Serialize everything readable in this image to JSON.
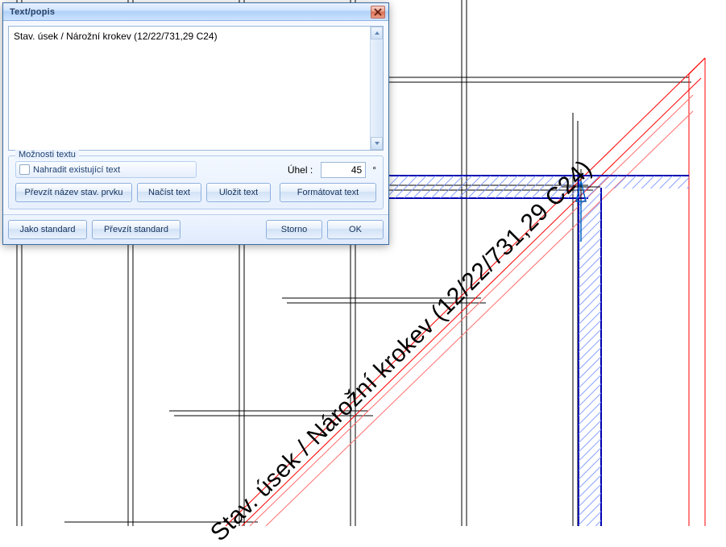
{
  "dialog": {
    "title": "Text/popis",
    "textarea_value": "Stav. úsek / Nárožní krokev (12/22/731,29 C24)",
    "options": {
      "legend": "Možnosti textu",
      "replace_label": "Nahradit existující text",
      "angle_label": "Úhel :",
      "angle_value": "45",
      "degree": "°",
      "btn_take_name": "Převzít název stav. prvku",
      "btn_load": "Načíst text",
      "btn_save": "Uložit text",
      "btn_format": "Formátovat text"
    },
    "footer": {
      "as_standard": "Jako standard",
      "take_standard": "Převzít standard",
      "storno": "Storno",
      "ok": "OK"
    }
  },
  "canvas": {
    "annotation_text": "Stav. úsek / Nárožní krokev (12/22/731,29 C24)",
    "annotation_angle_deg": 45
  }
}
